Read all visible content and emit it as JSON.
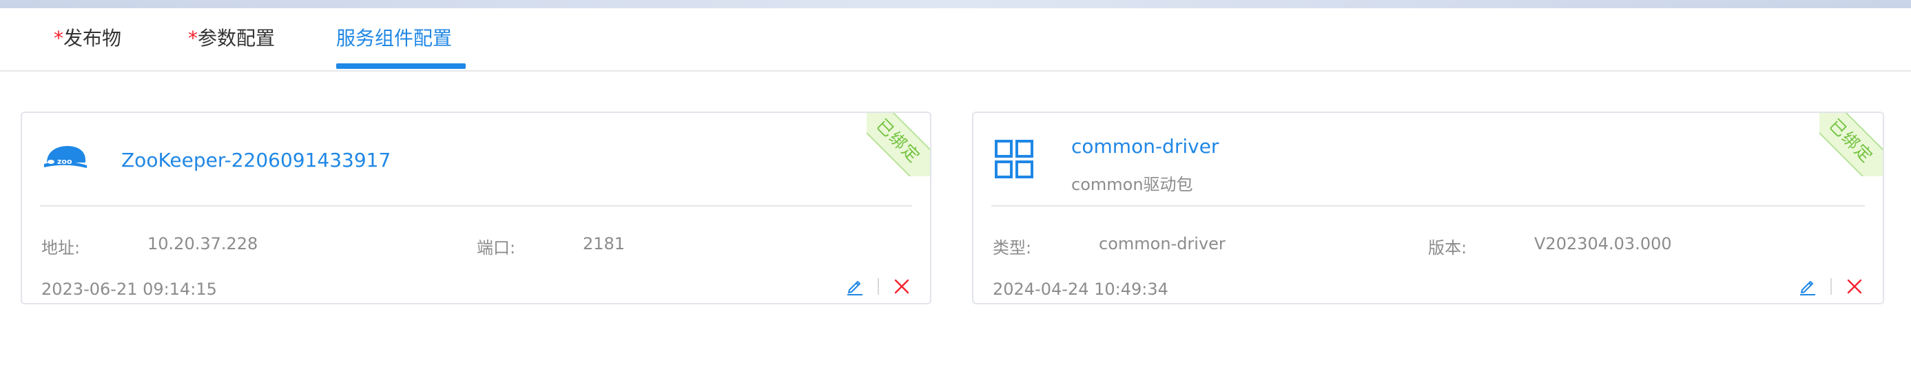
{
  "tabs": [
    {
      "required_mark": "*",
      "label": "发布物"
    },
    {
      "required_mark": "*",
      "label": "参数配置"
    },
    {
      "label": "服务组件配置"
    }
  ],
  "active_tab": 2,
  "colors": {
    "accent": "#1f87e5",
    "required": "#f5222d",
    "bound_badge_bg": "#eaf8d7",
    "bound_badge_text": "#73c240",
    "delete": "#f5222d"
  },
  "cards": [
    {
      "icon": "zookeeper-logo-icon",
      "title": "ZooKeeper-2206091433917",
      "badge": "已绑定",
      "fields": [
        {
          "label": "地址:",
          "value": "10.20.37.228"
        },
        {
          "label": "端口:",
          "value": "2181"
        }
      ],
      "time": "2023-06-21 09:14:15"
    },
    {
      "icon": "grid-apps-icon",
      "title": "common-driver",
      "subtitle": "common驱动包",
      "badge": "已绑定",
      "fields": [
        {
          "label": "类型:",
          "value": "common-driver"
        },
        {
          "label": "版本:",
          "value": "V202304.03.000"
        }
      ],
      "time": "2024-04-24 10:49:34"
    }
  ]
}
